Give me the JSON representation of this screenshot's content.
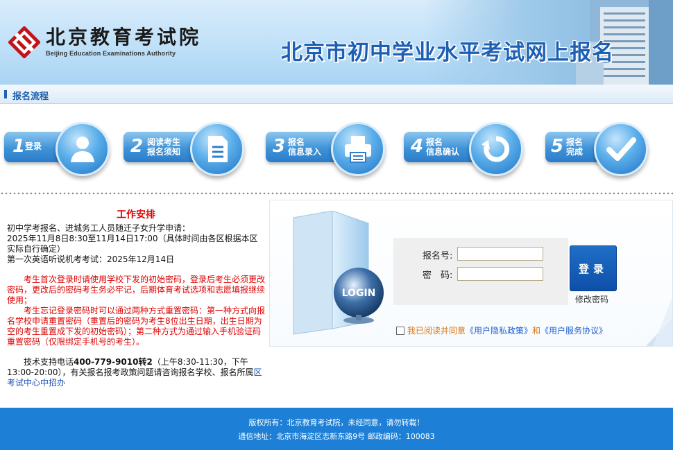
{
  "header": {
    "logo_cn": "北京教育考试院",
    "logo_en": "Beijing Education Examinations Authority",
    "site_title": "北京市初中学业水平考试网上报名"
  },
  "section": {
    "title": "报名流程"
  },
  "steps": [
    {
      "num": "1",
      "label_line1": "登录",
      "label_line2": "",
      "icon": "user-icon"
    },
    {
      "num": "2",
      "label_line1": "阅读考生",
      "label_line2": "报名须知",
      "icon": "document-icon"
    },
    {
      "num": "3",
      "label_line1": "报名",
      "label_line2": "信息录入",
      "icon": "printer-icon"
    },
    {
      "num": "4",
      "label_line1": "报名",
      "label_line2": "信息确认",
      "icon": "refresh-icon"
    },
    {
      "num": "5",
      "label_line1": "报名",
      "label_line2": "完成",
      "icon": "checkmark-icon"
    }
  ],
  "info": {
    "heading": "工作安排",
    "line1": "初中学考报名、进城务工人员随迁子女升学申请：",
    "line2": "2025年11月8日8:30至11月14日17:00（具体时间由各区根据本区实际自行确定）",
    "line3": "第一次英语听说机考考试：2025年12月14日",
    "red1": "考生首次登录时请使用学校下发的初始密码，登录后考生必须更改密码，更改后的密码考生务必牢记，后期体育考试选项和志愿填报继续使用；",
    "red2": "考生忘记登录密码时可以通过两种方式重置密码：第一种方式向报名学校申请重置密码（重置后的密码为考生8位出生日期，出生日期为空的考生重置成下发的初始密码）；第二种方式为通过输入手机验证码重置密码（仅限绑定手机号的考生）。",
    "support_prefix": "技术支持电话",
    "support_phone": "400-779-9010转2",
    "support_hours": "（上午8:30-11:30，下午13:00-20:00），有关报名报考政策问题请咨询报名学校、报名所属",
    "support_link": "区考试中心中招办"
  },
  "login": {
    "folder_label": "LOGIN",
    "username_label": "报名号:",
    "password_label": "密　码:",
    "username_value": "",
    "password_value": "",
    "login_button": "登录",
    "change_password": "修改密码",
    "agree_text": "我已阅读并同意",
    "privacy_link": "《用户隐私政策》",
    "and_text": "和",
    "service_link": "《用户服务协议》"
  },
  "footer": {
    "copyright": "版权所有：北京教育考试院，未经同意，请勿转载！",
    "address": "通信地址：北京市海淀区志新东路9号  邮政编码：100083"
  },
  "colors": {
    "brand_blue": "#1e7fd6",
    "accent_red": "#dd0000",
    "link_blue": "#1e5fd0"
  }
}
